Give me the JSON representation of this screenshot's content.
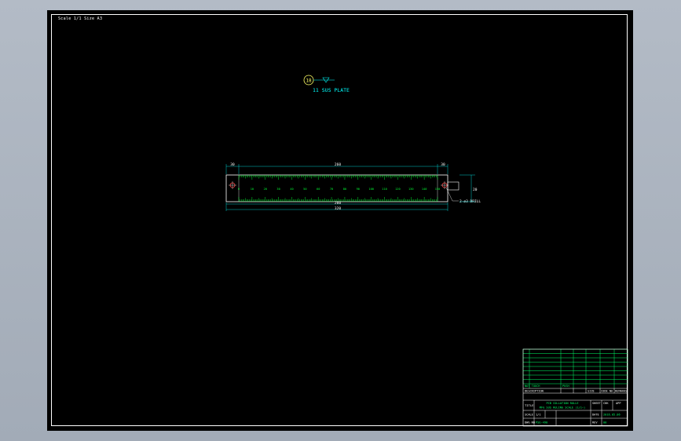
{
  "sheet": {
    "corner_note": "Scale 1/1   Size A3"
  },
  "callout": {
    "number": "18",
    "label": "11 SUS PLATE"
  },
  "part": {
    "dim_top_left": "30",
    "dim_top_mid": "260",
    "dim_top_right": "30",
    "dim_bottom_inner": "260",
    "dim_bottom_overall": "320",
    "dim_side": "20",
    "scale_numbers": [
      "0",
      "10",
      "20",
      "30",
      "40",
      "50",
      "60",
      "70",
      "80",
      "90",
      "100",
      "110",
      "120",
      "130",
      "140",
      "150"
    ],
    "hole_note": "2-ø3 DRILL"
  },
  "title_block": {
    "customer": "NOT TOUCH",
    "project": "PUSH",
    "col_a": "SIZE",
    "col_b": "CODE NO",
    "col_c": "REMARKS",
    "description_label": "DESCRIPTION",
    "title_label": "TITLE",
    "title_line1": "PCB COLLATION RULLE",
    "title_line2": "MFG SUS RULING SCALE (1/1~)",
    "scale_label": "SCALE",
    "scale_value": "1/1",
    "dwg_label": "DWG NO",
    "dwg_value": "PSE-490",
    "date_label": "DATE",
    "date_value": "2016.05.06",
    "rev_label": "REV",
    "rev_value": "00",
    "chk_label": "CHK",
    "app_label": "APP",
    "sheet_label": "SHEET"
  }
}
